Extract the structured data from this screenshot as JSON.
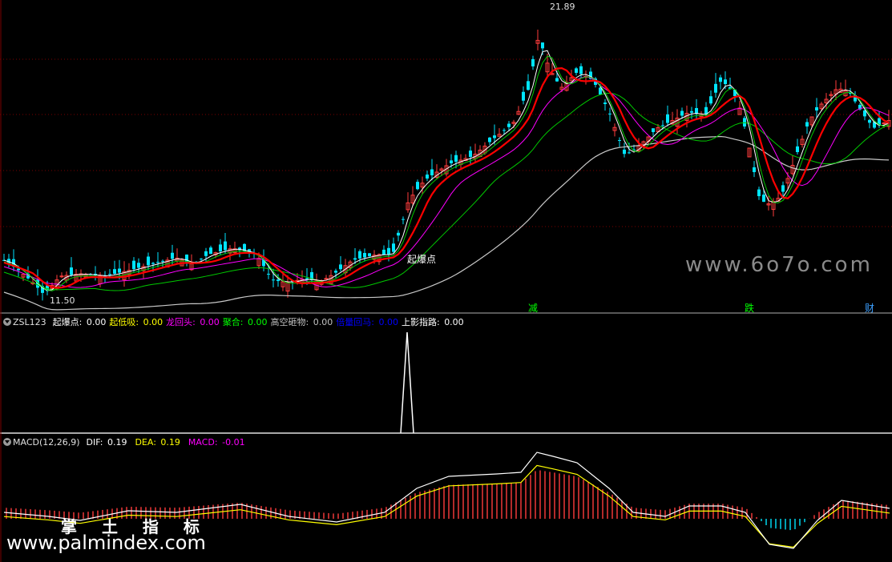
{
  "main_chart": {
    "price_high_label": "21.89",
    "price_low_label": "11.50",
    "signal_label": "起爆点",
    "event_markers": [
      "减",
      "跌",
      "财"
    ],
    "watermark": "www.6o7o.com"
  },
  "indicator_panel": {
    "name": "ZSL123",
    "fields": [
      {
        "label": "起爆点:",
        "value": "0.00",
        "color": "#ffffff"
      },
      {
        "label": "起低吸:",
        "value": "0.00",
        "color": "#ffff00"
      },
      {
        "label": "龙回头:",
        "value": "0.00",
        "color": "#ff00ff"
      },
      {
        "label": "聚合:",
        "value": "0.00",
        "color": "#00ff00"
      },
      {
        "label": "高空砸物:",
        "value": "0.00",
        "color": "#c0c0c0"
      },
      {
        "label": "倍量回马:",
        "value": "0.00",
        "color": "#0000ff"
      },
      {
        "label": "上影指路:",
        "value": "0.00",
        "color": "#ffffff"
      }
    ]
  },
  "macd_panel": {
    "name": "MACD(12,26,9)",
    "fields": [
      {
        "label": "DIF:",
        "value": "0.19",
        "color": "#ffffff"
      },
      {
        "label": "DEA:",
        "value": "0.19",
        "color": "#ffff00"
      },
      {
        "label": "MACD:",
        "value": "-0.01",
        "color": "#ff00ff"
      }
    ],
    "watermark_cn": "掌 土 指 标",
    "watermark_url": "www.palmindex.com"
  },
  "colors": {
    "up": "#ff3c3c",
    "down": "#00e5ff",
    "ma5": "#ffffff",
    "ma10": "#ffff00",
    "ma20": "#ff00ff",
    "ma60": "#00c800",
    "ma120": "#c8c8c8",
    "red_line": "#ff0000",
    "grid": "#7a0000"
  }
}
